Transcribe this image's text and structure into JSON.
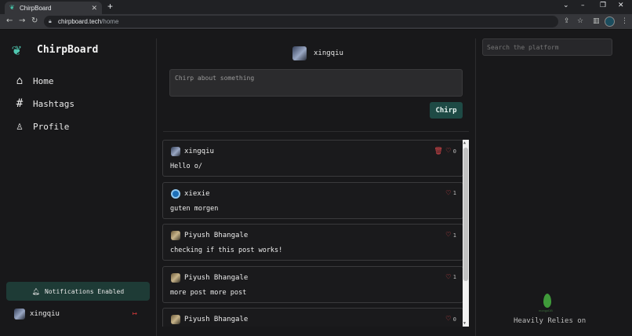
{
  "browser": {
    "tab_title": "ChirpBoard",
    "tab_close": "✕",
    "new_tab": "+",
    "url_domain": "chirpboard.tech",
    "url_path": "/home"
  },
  "app": {
    "brand": "ChirpBoard",
    "menu": [
      {
        "label": "Home",
        "icon": "home-icon"
      },
      {
        "label": "Hashtags",
        "icon": "hashtag-icon"
      },
      {
        "label": "Profile",
        "icon": "user-icon"
      }
    ],
    "notifications_label": "Notifications Enabled",
    "current_user": "xingqiu",
    "composer_placeholder": "Chirp about something",
    "chirp_button": "Chirp",
    "search_placeholder": "Search the platform",
    "footer_text": "Heavily Relies on",
    "footer_logo_text": "mongoDB"
  },
  "posts": [
    {
      "author": "xingqiu",
      "text": "Hello o/",
      "likes": "0",
      "can_delete": true,
      "avatar": "avatar-anime"
    },
    {
      "author": "xiexie",
      "text": "guten morgen",
      "likes": "1",
      "can_delete": false,
      "avatar": "avatar-blue"
    },
    {
      "author": "Piyush Bhangale",
      "text": "checking if this post works!",
      "likes": "1",
      "can_delete": false,
      "avatar": "avatar-bird"
    },
    {
      "author": "Piyush Bhangale",
      "text": "more post more post",
      "likes": "1",
      "can_delete": false,
      "avatar": "avatar-bird"
    },
    {
      "author": "Piyush Bhangale",
      "text": "",
      "likes": "0",
      "can_delete": false,
      "avatar": "avatar-bird"
    }
  ],
  "colors": {
    "accent": "#1e4a45",
    "brand": "#4fc7b0",
    "danger": "#e0484c"
  }
}
